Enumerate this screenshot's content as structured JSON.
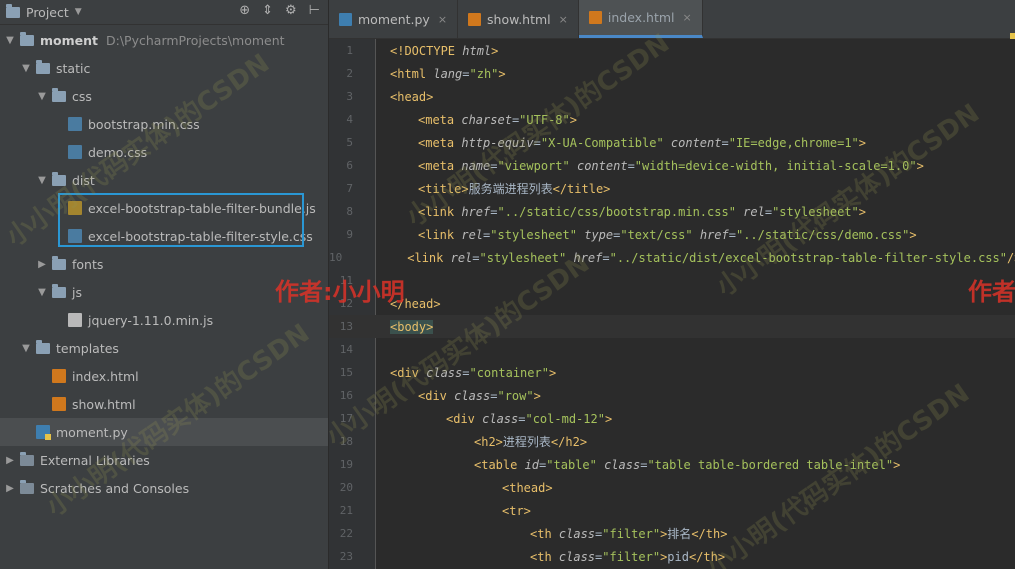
{
  "project_panel": {
    "title": "Project",
    "tree": [
      {
        "label": "moment",
        "path": "D:\\PycharmProjects\\moment",
        "depth": 0,
        "kind": "folder",
        "expanded": true
      },
      {
        "label": "static",
        "depth": 1,
        "kind": "folder",
        "expanded": true
      },
      {
        "label": "css",
        "depth": 2,
        "kind": "folder",
        "expanded": true
      },
      {
        "label": "bootstrap.min.css",
        "depth": 3,
        "kind": "css"
      },
      {
        "label": "demo.css",
        "depth": 3,
        "kind": "css"
      },
      {
        "label": "dist",
        "depth": 2,
        "kind": "folder",
        "expanded": true
      },
      {
        "label": "excel-bootstrap-table-filter-bundle.js",
        "depth": 3,
        "kind": "js"
      },
      {
        "label": "excel-bootstrap-table-filter-style.css",
        "depth": 3,
        "kind": "css"
      },
      {
        "label": "fonts",
        "depth": 2,
        "kind": "folder",
        "expanded": false
      },
      {
        "label": "js",
        "depth": 2,
        "kind": "folder",
        "expanded": true
      },
      {
        "label": "jquery-1.11.0.min.js",
        "depth": 3,
        "kind": "txt"
      },
      {
        "label": "templates",
        "depth": 1,
        "kind": "folder",
        "expanded": true
      },
      {
        "label": "index.html",
        "depth": 2,
        "kind": "html"
      },
      {
        "label": "show.html",
        "depth": 2,
        "kind": "html"
      },
      {
        "label": "moment.py",
        "depth": 1,
        "kind": "py",
        "selected": true
      },
      {
        "label": "External Libraries",
        "depth": 0,
        "kind": "lib",
        "expanded": false
      },
      {
        "label": "Scratches and Consoles",
        "depth": 0,
        "kind": "lib",
        "expanded": false
      }
    ]
  },
  "tabs": [
    {
      "label": "moment.py",
      "kind": "py",
      "active": false
    },
    {
      "label": "show.html",
      "kind": "html",
      "active": false
    },
    {
      "label": "index.html",
      "kind": "html",
      "active": true
    }
  ],
  "editor": {
    "current_line": 13,
    "lines": [
      {
        "n": "1",
        "indent": 0,
        "tokens": [
          [
            "tag",
            "<!DOCTYPE "
          ],
          [
            "attr",
            "html"
          ],
          [
            "tag",
            ">"
          ]
        ]
      },
      {
        "n": "2",
        "indent": 0,
        "tokens": [
          [
            "tag",
            "<html "
          ],
          [
            "attr",
            "lang"
          ],
          [
            "text",
            "="
          ],
          [
            "val",
            "\"zh\""
          ],
          [
            "tag",
            ">"
          ]
        ]
      },
      {
        "n": "3",
        "indent": 0,
        "tokens": [
          [
            "tag",
            "<head>"
          ]
        ]
      },
      {
        "n": "4",
        "indent": 1,
        "tokens": [
          [
            "tag",
            "<meta "
          ],
          [
            "attr",
            "charset"
          ],
          [
            "text",
            "="
          ],
          [
            "val",
            "\"UTF-8\""
          ],
          [
            "tag",
            ">"
          ]
        ]
      },
      {
        "n": "5",
        "indent": 1,
        "tokens": [
          [
            "tag",
            "<meta "
          ],
          [
            "attr",
            "http-equiv"
          ],
          [
            "text",
            "="
          ],
          [
            "val",
            "\"X-UA-Compatible\""
          ],
          [
            "text",
            " "
          ],
          [
            "attr",
            "content"
          ],
          [
            "text",
            "="
          ],
          [
            "val",
            "\"IE=edge,chrome=1\""
          ],
          [
            "tag",
            ">"
          ]
        ]
      },
      {
        "n": "6",
        "indent": 1,
        "tokens": [
          [
            "tag",
            "<meta "
          ],
          [
            "attr",
            "name"
          ],
          [
            "text",
            "="
          ],
          [
            "val",
            "\"viewport\""
          ],
          [
            "text",
            " "
          ],
          [
            "attr",
            "content"
          ],
          [
            "text",
            "="
          ],
          [
            "val",
            "\"width=device-width, initial-scale=1.0\""
          ],
          [
            "tag",
            ">"
          ]
        ]
      },
      {
        "n": "7",
        "indent": 1,
        "tokens": [
          [
            "tag",
            "<title>"
          ],
          [
            "text",
            "服务端进程列表"
          ],
          [
            "tag",
            "</title>"
          ]
        ]
      },
      {
        "n": "8",
        "indent": 1,
        "tokens": [
          [
            "tag",
            "<link "
          ],
          [
            "attr",
            "href"
          ],
          [
            "text",
            "="
          ],
          [
            "val",
            "\"../static/css/bootstrap.min.css\""
          ],
          [
            "text",
            " "
          ],
          [
            "attr",
            "rel"
          ],
          [
            "text",
            "="
          ],
          [
            "val",
            "\"stylesheet\""
          ],
          [
            "tag",
            ">"
          ]
        ]
      },
      {
        "n": "9",
        "indent": 1,
        "tokens": [
          [
            "tag",
            "<link "
          ],
          [
            "attr",
            "rel"
          ],
          [
            "text",
            "="
          ],
          [
            "val",
            "\"stylesheet\""
          ],
          [
            "text",
            " "
          ],
          [
            "attr",
            "type"
          ],
          [
            "text",
            "="
          ],
          [
            "val",
            "\"text/css\""
          ],
          [
            "text",
            " "
          ],
          [
            "attr",
            "href"
          ],
          [
            "text",
            "="
          ],
          [
            "val",
            "\"../static/css/demo.css\""
          ],
          [
            "tag",
            ">"
          ]
        ]
      },
      {
        "n": "10",
        "indent": 1,
        "tokens": [
          [
            "tag",
            "<link "
          ],
          [
            "attr",
            "rel"
          ],
          [
            "text",
            "="
          ],
          [
            "val",
            "\"stylesheet\""
          ],
          [
            "text",
            " "
          ],
          [
            "attr",
            "href"
          ],
          [
            "text",
            "="
          ],
          [
            "val",
            "\"../static/dist/excel-bootstrap-table-filter-style.css\""
          ],
          [
            "tag",
            "/>"
          ]
        ]
      },
      {
        "n": "11",
        "indent": 0,
        "tokens": []
      },
      {
        "n": "12",
        "indent": 0,
        "tokens": [
          [
            "tag",
            "</head>"
          ]
        ]
      },
      {
        "n": "13",
        "indent": 0,
        "tokens": [
          [
            "body",
            "<body>"
          ]
        ]
      },
      {
        "n": "14",
        "indent": 0,
        "tokens": []
      },
      {
        "n": "15",
        "indent": 0,
        "tokens": [
          [
            "tag",
            "<div "
          ],
          [
            "attr",
            "class"
          ],
          [
            "text",
            "="
          ],
          [
            "val",
            "\"container\""
          ],
          [
            "tag",
            ">"
          ]
        ]
      },
      {
        "n": "16",
        "indent": 1,
        "tokens": [
          [
            "tag",
            "<div "
          ],
          [
            "attr",
            "class"
          ],
          [
            "text",
            "="
          ],
          [
            "val",
            "\"row\""
          ],
          [
            "tag",
            ">"
          ]
        ]
      },
      {
        "n": "17",
        "indent": 2,
        "tokens": [
          [
            "tag",
            "<div "
          ],
          [
            "attr",
            "class"
          ],
          [
            "text",
            "="
          ],
          [
            "val",
            "\"col-md-12\""
          ],
          [
            "tag",
            ">"
          ]
        ]
      },
      {
        "n": "18",
        "indent": 3,
        "tokens": [
          [
            "tag",
            "<h2>"
          ],
          [
            "text",
            "进程列表"
          ],
          [
            "tag",
            "</h2>"
          ]
        ]
      },
      {
        "n": "19",
        "indent": 3,
        "tokens": [
          [
            "tag",
            "<table "
          ],
          [
            "attr",
            "id"
          ],
          [
            "text",
            "="
          ],
          [
            "val",
            "\"table\""
          ],
          [
            "text",
            " "
          ],
          [
            "attr",
            "class"
          ],
          [
            "text",
            "="
          ],
          [
            "val",
            "\"table table-bordered table-intel\""
          ],
          [
            "tag",
            ">"
          ]
        ]
      },
      {
        "n": "20",
        "indent": 4,
        "tokens": [
          [
            "tag",
            "<thead>"
          ]
        ]
      },
      {
        "n": "21",
        "indent": 4,
        "tokens": [
          [
            "tag",
            "<tr>"
          ]
        ]
      },
      {
        "n": "22",
        "indent": 5,
        "tokens": [
          [
            "tag",
            "<th "
          ],
          [
            "attr",
            "class"
          ],
          [
            "text",
            "="
          ],
          [
            "val",
            "\"filter\""
          ],
          [
            "tag",
            ">"
          ],
          [
            "text",
            "排名"
          ],
          [
            "tag",
            "</th>"
          ]
        ]
      },
      {
        "n": "23",
        "indent": 5,
        "tokens": [
          [
            "tag",
            "<th "
          ],
          [
            "attr",
            "class"
          ],
          [
            "text",
            "="
          ],
          [
            "val",
            "\"filter\""
          ],
          [
            "tag",
            ">"
          ],
          [
            "text",
            "pid"
          ],
          [
            "tag",
            "</th>"
          ]
        ]
      }
    ]
  },
  "watermark": {
    "text": "小小明(代码实体)的CSDN",
    "author": "作者:小小明",
    "author_right": "作者"
  }
}
